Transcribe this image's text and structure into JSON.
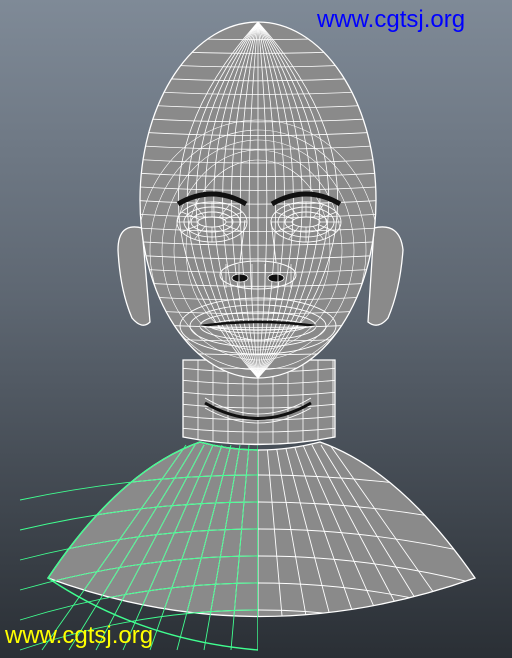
{
  "watermark": {
    "top_text": "www.cgtsj.org",
    "bottom_text": "www.cgtsj.org",
    "top_color": "#0000ff",
    "bottom_color": "#ffff00"
  },
  "viewport": {
    "background_top": "#7f8a97",
    "background_bottom": "#2a2f35",
    "mesh_fill": "#8a8a8a",
    "wire_color": "#ffffff",
    "selection_color": "#40ff90",
    "hard_edge_color": "#101010"
  }
}
